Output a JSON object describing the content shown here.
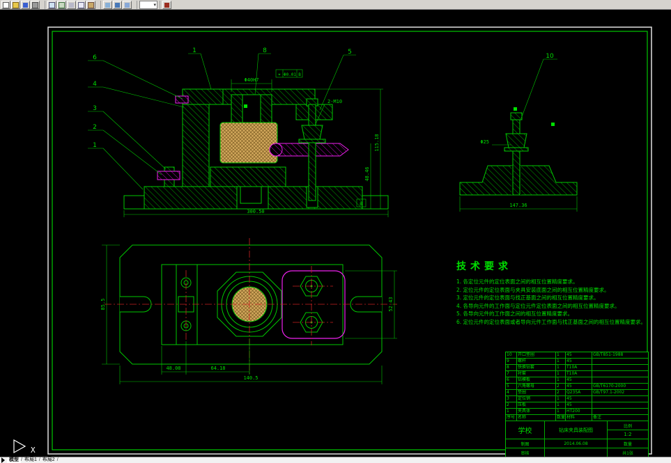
{
  "window": {
    "toolbar": {
      "icons": [
        "new",
        "open",
        "save",
        "print",
        "preview",
        "spell",
        "cut",
        "copy",
        "paste",
        "match-properties",
        "undo",
        "redo",
        "layer-dropdown",
        "color-swatch"
      ]
    },
    "tabs": [
      {
        "label": "模型",
        "active": true
      },
      {
        "label": "布局1",
        "active": false
      },
      {
        "label": "布局2",
        "active": false
      }
    ],
    "tabs_sep": "/"
  },
  "drawing": {
    "balloons": {
      "left": [
        "6",
        "4",
        "3",
        "2",
        "1"
      ],
      "top": [
        "1",
        "8",
        "5"
      ],
      "right": [
        "10"
      ]
    },
    "dims": {
      "front_width": "300.50",
      "front_h1": "115.18",
      "front_h2": "48.46",
      "bushing": "Φ40H7",
      "tol_sym": "⌖",
      "tol_val": "Φ0.01",
      "tol_datum": "B",
      "datum": "B",
      "bolt": "2-M10",
      "stud": "Φ25",
      "side_width": "147.36",
      "plan_a": "48.08",
      "plan_b": "64.18",
      "plan_w": "140.5",
      "plan_h": "85.5",
      "plan_r": "52.43"
    },
    "tech": {
      "title": "技术要求",
      "items": [
        "1. 各定位元件的定位表面之间的相互位置精度要求。",
        "2. 定位元件的定位表面与夹具安装底面之间的相互位置精度要求。",
        "3. 定位元件的定位表面与找正基面之间的相互位置精度要求。",
        "4. 各导向元件的工作面与定位元件定位表面之间的相互位置精度要求。",
        "5. 各导向元件的工作面之间的相互位置精度要求。",
        "6. 定位元件的定位表面或者导向元件工作面与找正基面之间的相互位置精度要求。"
      ]
    },
    "parts": {
      "headers": {
        "no": "序号",
        "name": "名称",
        "qty": "数量",
        "material": "材料",
        "remark": "备注"
      },
      "rows": [
        {
          "no": "10",
          "name": "开口垫圈",
          "qty": "1",
          "material": "45",
          "remark": "GB/T851-1988"
        },
        {
          "no": "9",
          "name": "螺杆",
          "qty": "1",
          "material": "45",
          "remark": ""
        },
        {
          "no": "8",
          "name": "快换钻套",
          "qty": "1",
          "material": "T10A",
          "remark": ""
        },
        {
          "no": "7",
          "name": "衬套",
          "qty": "1",
          "material": "T10A",
          "remark": ""
        },
        {
          "no": "6",
          "name": "钻模板",
          "qty": "1",
          "material": "45",
          "remark": ""
        },
        {
          "no": "5",
          "name": "六角螺母",
          "qty": "2",
          "material": "45",
          "remark": "GB/T6170-2000"
        },
        {
          "no": "4",
          "name": "垫圈",
          "qty": "2",
          "material": "Q235A",
          "remark": "GB/T97.1-2002"
        },
        {
          "no": "3",
          "name": "定位销",
          "qty": "1",
          "material": "45",
          "remark": ""
        },
        {
          "no": "2",
          "name": "压板",
          "qty": "1",
          "material": "45",
          "remark": ""
        },
        {
          "no": "1",
          "name": "夹具体",
          "qty": "1",
          "material": "HT200",
          "remark": ""
        }
      ]
    },
    "title_block": {
      "school": "学校",
      "title": "钻床夹具装配图",
      "scale_label": "比例",
      "scale": "1:2",
      "drawn_label": "制图",
      "date": "2014.06.08",
      "qty_label": "数量",
      "checked_label": "审核",
      "sheet": "共1张"
    }
  },
  "ucs": {
    "x_label": "X"
  }
}
